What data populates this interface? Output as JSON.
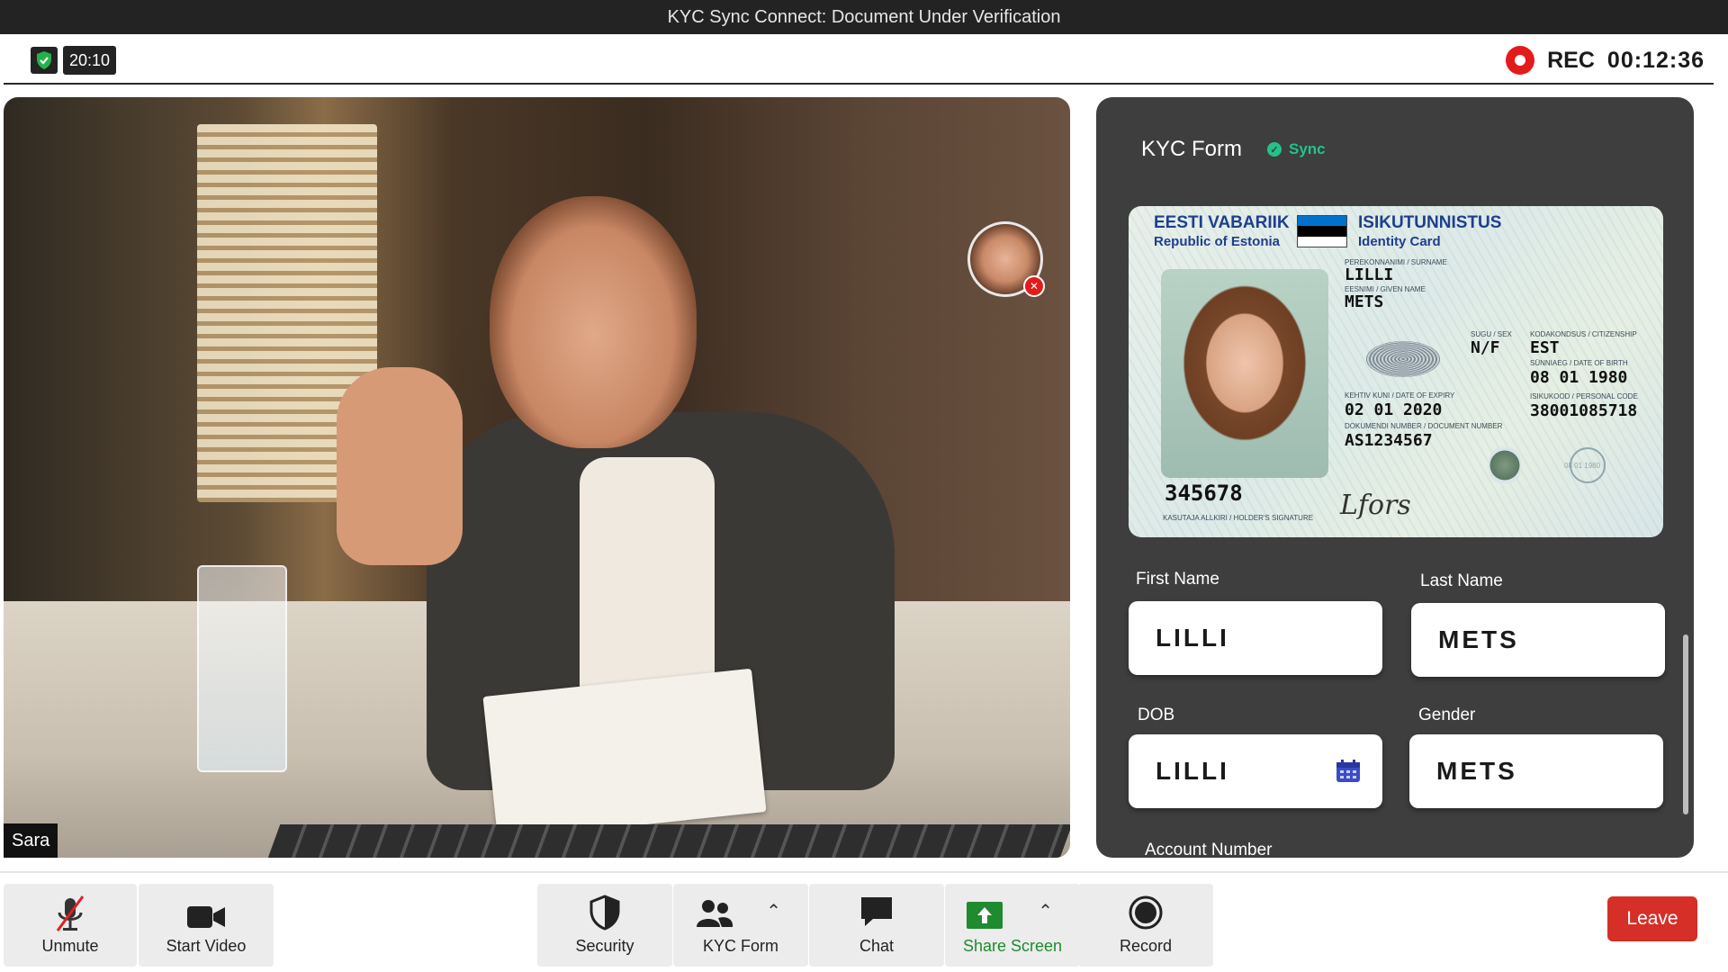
{
  "window": {
    "title": "KYC Sync Connect: Document Under Verification"
  },
  "status": {
    "clock": "20:10",
    "rec_label": "REC",
    "rec_time": "00:12:36"
  },
  "video": {
    "participant_name": "Sara"
  },
  "panel": {
    "title": "KYC Form",
    "sync_label": "Sync",
    "id_card": {
      "country": "EESTI VABARIIK",
      "country_en": "Republic of Estonia",
      "doc_type": "ISIKUTUNNISTUS",
      "doc_type_en": "Identity Card",
      "surname_label": "PEREKONNANIMI / SURNAME",
      "surname": "LILLI",
      "given_label": "EESNIMI / GIVEN NAME",
      "given": "METS",
      "sex_label": "SUGU / SEX",
      "sex": "N/F",
      "citizenship_label": "KODAKONDSUS / CITIZENSHIP",
      "citizenship": "EST",
      "dob_label": "SÜNNIAEG / DATE OF BIRTH",
      "dob": "08 01 1980",
      "expiry_label": "KEHTIV KUNI / DATE OF EXPIRY",
      "expiry": "02 01 2020",
      "personal_code_label": "ISIKUKOOD / PERSONAL CODE",
      "personal_code": "38001085718",
      "doc_number_label": "DOKUMENDI NUMBER / DOCUMENT NUMBER",
      "doc_number": "AS1234567",
      "card_number": "345678",
      "signature_label": "KASUTAJA ALLKIRI / HOLDER'S SIGNATURE",
      "signature": "Lfors",
      "holo_text": "08 01 1980"
    },
    "fields": {
      "first_name_label": "First Name",
      "first_name": "LILLI",
      "last_name_label": "Last Name",
      "last_name": "METS",
      "dob_label": "DOB",
      "dob": "LILLI",
      "gender_label": "Gender",
      "gender": "METS",
      "account_label": "Account Number"
    }
  },
  "toolbar": {
    "unmute": "Unmute",
    "start_video": "Start Video",
    "security": "Security",
    "kyc_form": "KYC Form",
    "chat": "Chat",
    "share_screen": "Share Screen",
    "record": "Record",
    "leave": "Leave"
  },
  "colors": {
    "rec_red": "#e31b1b",
    "sync_green": "#21c38a",
    "leave_red": "#d62f28",
    "share_green": "#1f8a2e",
    "id_blue": "#1d3f8f"
  },
  "icons": [
    "shield-check-icon",
    "record-dot-icon",
    "microphone-muted-icon",
    "video-camera-icon",
    "security-shield-icon",
    "participants-icon",
    "chat-bubble-icon",
    "share-screen-icon",
    "record-icon",
    "calendar-icon",
    "chevron-up-icon"
  ]
}
